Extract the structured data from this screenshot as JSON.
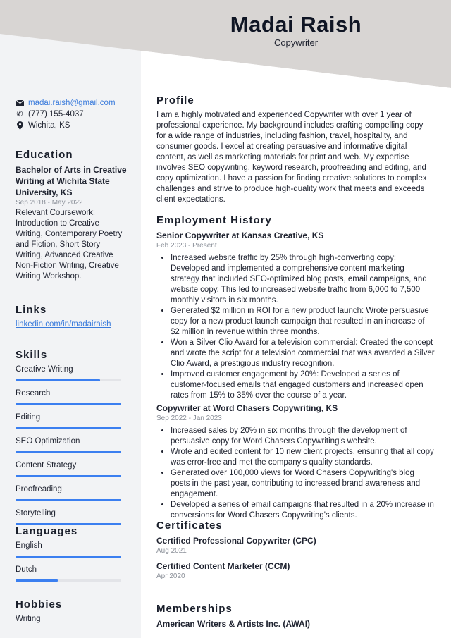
{
  "header": {
    "name": "Madai Raish",
    "role": "Copywriter"
  },
  "colors": {
    "accent": "#3b7ff0",
    "link": "#3a7bdc",
    "header_bg": "#d8d5d3",
    "sidebar_bg": "#f2f3f5"
  },
  "contact": {
    "email": "madai.raish@gmail.com",
    "phone": "(777) 155-4037",
    "location": "Wichita, KS"
  },
  "education": {
    "heading": "Education",
    "degree": "Bachelor of Arts in Creative Writing at Wichita State University, KS",
    "dates": "Sep 2018 - May 2022",
    "details": "Relevant Coursework: Introduction to Creative Writing, Contemporary Poetry and Fiction, Short Story Writing, Advanced Creative Non-Fiction Writing, Creative Writing Workshop."
  },
  "links": {
    "heading": "Links",
    "items": [
      "linkedin.com/in/madairaish"
    ]
  },
  "skills": {
    "heading": "Skills",
    "items": [
      {
        "label": "Creative Writing",
        "level": 0.8
      },
      {
        "label": "Research",
        "level": 1.0
      },
      {
        "label": "Editing",
        "level": 1.0
      },
      {
        "label": "SEO Optimization",
        "level": 1.0
      },
      {
        "label": "Content Strategy",
        "level": 1.0
      },
      {
        "label": "Proofreading",
        "level": 1.0
      },
      {
        "label": "Storytelling",
        "level": 1.0
      }
    ]
  },
  "languages": {
    "heading": "Languages",
    "items": [
      {
        "label": "English",
        "level": 1.0
      },
      {
        "label": "Dutch",
        "level": 0.4
      }
    ]
  },
  "hobbies": {
    "heading": "Hobbies",
    "items": [
      "Writing"
    ]
  },
  "profile": {
    "heading": "Profile",
    "text": "I am a highly motivated and experienced Copywriter with over 1 year of professional experience. My background includes crafting compelling copy for a wide range of industries, including fashion, travel, hospitality, and consumer goods. I excel at creating persuasive and informative digital content, as well as marketing materials for print and web. My expertise involves SEO copywriting, keyword research, proofreading and editing, and copy optimization. I have a passion for finding creative solutions to complex challenges and strive to produce high-quality work that meets and exceeds client expectations."
  },
  "employment": {
    "heading": "Employment History",
    "jobs": [
      {
        "title": "Senior Copywriter at Kansas Creative, KS",
        "dates": "Feb 2023 - Present",
        "bullets": [
          "Increased website traffic by 25% through high-converting copy: Developed and implemented a comprehensive content marketing strategy that included SEO-optimized blog posts, email campaigns, and website copy. This led to increased website traffic from 6,000 to 7,500 monthly visitors in six months.",
          "Generated $2 million in ROI for a new product launch: Wrote persuasive copy for a new product launch campaign that resulted in an increase of $2 million in revenue within three months.",
          "Won a Silver Clio Award for a television commercial: Created the concept and wrote the script for a television commercial that was awarded a Silver Clio Award, a prestigious industry recognition.",
          "Improved customer engagement by 20%: Developed a series of customer-focused emails that engaged customers and increased open rates from 15% to 35% over the course of a year."
        ]
      },
      {
        "title": "Copywriter at Word Chasers Copywriting, KS",
        "dates": "Sep 2022 - Jan 2023",
        "bullets": [
          "Increased sales by 20% in six months through the development of persuasive copy for Word Chasers Copywriting's website.",
          "Wrote and edited content for 10 new client projects, ensuring that all copy was error-free and met the company's quality standards.",
          "Generated over 100,000 views for Word Chasers Copywriting's blog posts in the past year, contributing to increased brand awareness and engagement.",
          "Developed a series of email campaigns that resulted in a 20% increase in conversions for Word Chasers Copywriting's clients."
        ]
      }
    ]
  },
  "certificates": {
    "heading": "Certificates",
    "items": [
      {
        "title": "Certified Professional Copywriter (CPC)",
        "date": "Aug 2021"
      },
      {
        "title": "Certified Content Marketer (CCM)",
        "date": "Apr 2020"
      }
    ]
  },
  "memberships": {
    "heading": "Memberships",
    "items": [
      "American Writers & Artists Inc. (AWAI)"
    ]
  }
}
